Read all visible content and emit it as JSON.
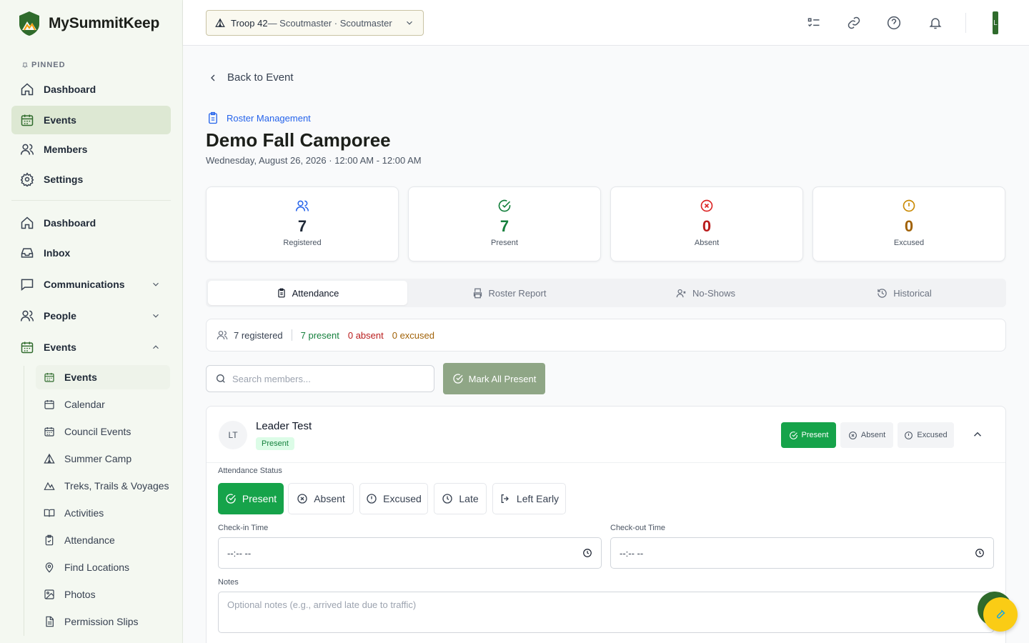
{
  "app": {
    "name": "MySummitKeep"
  },
  "sidebar": {
    "pinned_label": "PINNED",
    "pinned": [
      {
        "label": "Dashboard",
        "icon": "home-icon"
      },
      {
        "label": "Events",
        "icon": "calendar-icon",
        "active": true
      },
      {
        "label": "Members",
        "icon": "users-icon"
      },
      {
        "label": "Settings",
        "icon": "gear-icon"
      }
    ],
    "main": [
      {
        "label": "Dashboard",
        "icon": "home-icon"
      },
      {
        "label": "Inbox",
        "icon": "inbox-icon"
      },
      {
        "label": "Communications",
        "icon": "message-icon",
        "expandable": true
      },
      {
        "label": "People",
        "icon": "users-icon",
        "expandable": true
      },
      {
        "label": "Events",
        "icon": "calendar-icon",
        "expanded": true
      }
    ],
    "event_sub": [
      {
        "label": "Events",
        "icon": "calendar-icon",
        "active": true
      },
      {
        "label": "Calendar",
        "icon": "calendar-icon"
      },
      {
        "label": "Council Events",
        "icon": "calendar-grid-icon"
      },
      {
        "label": "Summer Camp",
        "icon": "tent-icon"
      },
      {
        "label": "Treks, Trails & Voyages",
        "icon": "mountain-icon"
      },
      {
        "label": "Activities",
        "icon": "book-icon"
      },
      {
        "label": "Attendance",
        "icon": "clipboard-check-icon"
      },
      {
        "label": "Find Locations",
        "icon": "map-pin-icon"
      },
      {
        "label": "Photos",
        "icon": "image-icon"
      },
      {
        "label": "Permission Slips",
        "icon": "document-icon"
      }
    ]
  },
  "header": {
    "troop": "Troop 42",
    "troop_role": " — Scoutmaster · Scoutmaster",
    "avatar_initial": "L"
  },
  "page": {
    "back_label": "Back to Event",
    "breadcrumb": "Roster Management",
    "title": "Demo Fall Camporee",
    "date": "Wednesday, August 26, 2026 · 12:00 AM - 12:00 AM"
  },
  "stats": [
    {
      "value": "7",
      "label": "Registered",
      "color": "#1f2937",
      "icon": "users-icon"
    },
    {
      "value": "7",
      "label": "Present",
      "color": "#15803d",
      "icon": "check-circle-icon"
    },
    {
      "value": "0",
      "label": "Absent",
      "color": "#b91c1c",
      "icon": "x-circle-icon"
    },
    {
      "value": "0",
      "label": "Excused",
      "color": "#a16207",
      "icon": "alert-circle-icon"
    }
  ],
  "tabs": [
    {
      "label": "Attendance",
      "icon": "clipboard-icon",
      "active": true
    },
    {
      "label": "Roster Report",
      "icon": "printer-icon"
    },
    {
      "label": "No-Shows",
      "icon": "user-x-icon"
    },
    {
      "label": "Historical",
      "icon": "history-icon"
    }
  ],
  "summary": {
    "registered": "7 registered",
    "present": "7 present",
    "absent": "0 absent",
    "excused": "0 excused"
  },
  "search": {
    "placeholder": "Search members..."
  },
  "mark_all": "Mark All Present",
  "member": {
    "initials": "LT",
    "name": "Leader Test",
    "status": "Present",
    "quick": {
      "present": "Present",
      "absent": "Absent",
      "excused": "Excused"
    },
    "attendance_label": "Attendance Status",
    "statuses": [
      {
        "label": "Present",
        "icon": "check-circle-icon",
        "active": true
      },
      {
        "label": "Absent",
        "icon": "x-circle-icon"
      },
      {
        "label": "Excused",
        "icon": "alert-circle-icon"
      },
      {
        "label": "Late",
        "icon": "clock-icon"
      },
      {
        "label": "Left Early",
        "icon": "log-out-icon"
      }
    ],
    "checkin_label": "Check-in Time",
    "checkin_value": "--:-- --",
    "checkout_label": "Check-out Time",
    "checkout_value": "--:-- --",
    "notes_label": "Notes",
    "notes_placeholder": "Optional notes (e.g., arrived late due to traffic)"
  },
  "colors": {
    "brand_green": "#2f6b2c",
    "present_green": "#16a34a",
    "absent_red": "#b91c1c",
    "excused_amber": "#a16207",
    "link_blue": "#2563eb"
  }
}
